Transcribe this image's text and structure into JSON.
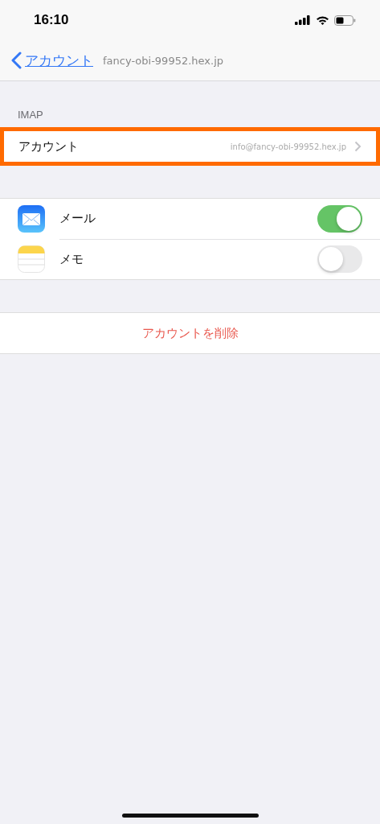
{
  "status_bar": {
    "time": "16:10"
  },
  "nav": {
    "back": "アカウント",
    "title": "fancy-obi-99952.hex.jp"
  },
  "section": {
    "header": "IMAP",
    "rows": [
      {
        "label": "アカウント",
        "value": "info@fancy-obi-99952.hex.jp",
        "highlighted": true
      }
    ]
  },
  "apps": [
    {
      "kind": "mail",
      "label": "メール",
      "on": true
    },
    {
      "kind": "notes",
      "label": "メモ",
      "on": false
    }
  ],
  "delete_button": "アカウントを削除"
}
